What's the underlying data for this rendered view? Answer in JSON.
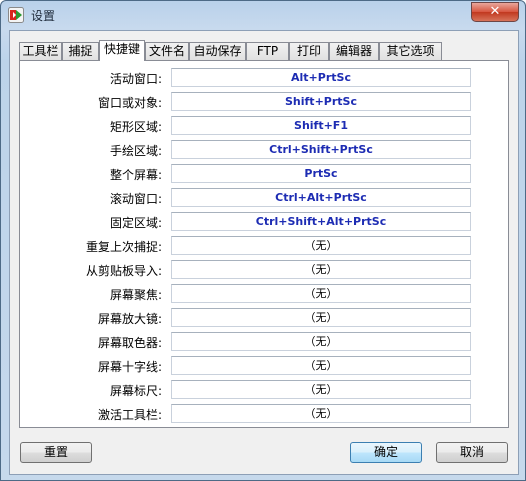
{
  "window": {
    "title": "设置",
    "close_glyph": "✕"
  },
  "tabs": [
    {
      "label": "工具栏"
    },
    {
      "label": "捕捉"
    },
    {
      "label": "快捷键",
      "active": true
    },
    {
      "label": "文件名"
    },
    {
      "label": "自动保存"
    },
    {
      "label": "FTP"
    },
    {
      "label": "打印"
    },
    {
      "label": "编辑器"
    },
    {
      "label": "其它选项"
    }
  ],
  "hotkeys": [
    {
      "label": "活动窗口:",
      "value": "Alt+PrtSc"
    },
    {
      "label": "窗口或对象:",
      "value": "Shift+PrtSc"
    },
    {
      "label": "矩形区域:",
      "value": "Shift+F1"
    },
    {
      "label": "手绘区域:",
      "value": "Ctrl+Shift+PrtSc"
    },
    {
      "label": "整个屏幕:",
      "value": "PrtSc"
    },
    {
      "label": "滚动窗口:",
      "value": "Ctrl+Alt+PrtSc"
    },
    {
      "label": "固定区域:",
      "value": "Ctrl+Shift+Alt+PrtSc"
    },
    {
      "label": "重复上次捕捉:",
      "value": "（无）"
    },
    {
      "label": "从剪贴板导入:",
      "value": "（无）"
    },
    {
      "label": "屏幕聚焦:",
      "value": "（无）"
    },
    {
      "label": "屏幕放大镜:",
      "value": "（无）"
    },
    {
      "label": "屏幕取色器:",
      "value": "（无）"
    },
    {
      "label": "屏幕十字线:",
      "value": "（无）"
    },
    {
      "label": "屏幕标尺:",
      "value": "（无）"
    },
    {
      "label": "激活工具栏:",
      "value": "（无）"
    }
  ],
  "buttons": {
    "reset": "重置",
    "ok": "确定",
    "cancel": "取消"
  },
  "colors": {
    "hotkey_set": "#1d2cb3",
    "hotkey_none": "#000000"
  }
}
